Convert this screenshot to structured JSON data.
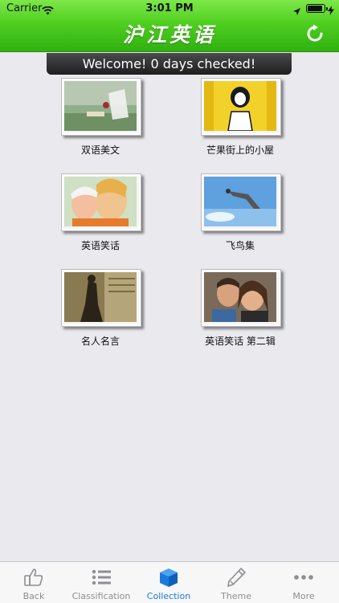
{
  "status_bar": {
    "carrier": "Carrier",
    "time": "3:01 PM"
  },
  "nav": {
    "title": "沪江英语",
    "refresh_icon": "refresh-icon"
  },
  "banner": {
    "text": "Welcome! 0 days checked!"
  },
  "collection": {
    "items": [
      {
        "label": "双语美文"
      },
      {
        "label": "芒果街上的小屋"
      },
      {
        "label": "英语笑话"
      },
      {
        "label": "飞鸟集"
      },
      {
        "label": "名人名言"
      },
      {
        "label": "英语笑话 第二辑"
      }
    ]
  },
  "tabbar": {
    "tabs": [
      {
        "label": "Back",
        "icon": "thumbs-up-icon"
      },
      {
        "label": "Classification",
        "icon": "list-icon"
      },
      {
        "label": "Collection",
        "icon": "cube-icon"
      },
      {
        "label": "Theme",
        "icon": "pencil-icon"
      },
      {
        "label": "More",
        "icon": "more-dots-icon"
      }
    ],
    "active": "Collection"
  },
  "colors": {
    "accent": "#1a7ae0",
    "nav_green": "#3cc21a",
    "banner": "#2a2a2a"
  }
}
